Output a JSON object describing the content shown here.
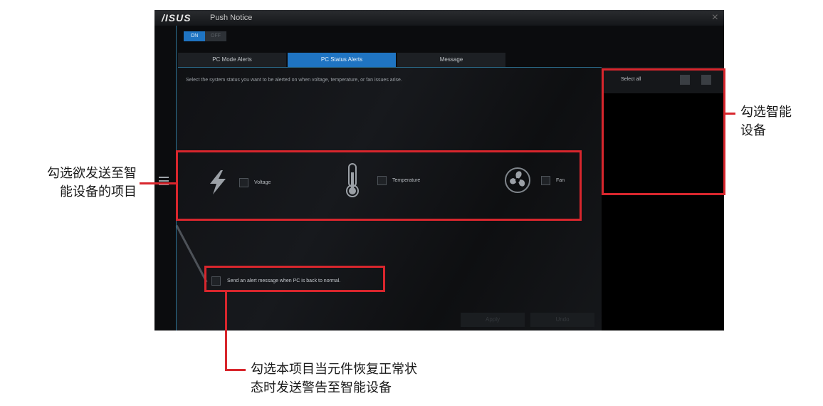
{
  "window": {
    "logo": "/ISUS",
    "title": "Push Notice",
    "close_glyph": "×"
  },
  "toggle": {
    "on_label": "ON",
    "off_label": "OFF"
  },
  "tabs": [
    {
      "label": "PC Mode Alerts"
    },
    {
      "label": "PC Status Alerts",
      "active": true
    },
    {
      "label": "Message"
    }
  ],
  "description": "Select the system status you want to be alerted on when voltage, temperature, or fan issues arise.",
  "status_items": [
    {
      "icon": "lightning-icon",
      "label": "Voltage"
    },
    {
      "icon": "thermometer-icon",
      "label": "Temperature"
    },
    {
      "icon": "fan-icon",
      "label": "Fan"
    }
  ],
  "normal_alert": {
    "label": "Send an alert message when PC is back to normal."
  },
  "buttons": {
    "apply": "Apply",
    "undo": "Undo"
  },
  "devices_panel": {
    "select_all": "Select all"
  },
  "annotations": {
    "items": [
      "勾选欲发送至智",
      "能设备的项目"
    ],
    "devices": [
      "勾选智能",
      "设备"
    ],
    "recover": [
      "勾选本项目当元件恢复正常状",
      "态时发送警告至智能设备"
    ]
  },
  "colors": {
    "highlight": "#d8262d",
    "accent": "#1f74c2"
  }
}
